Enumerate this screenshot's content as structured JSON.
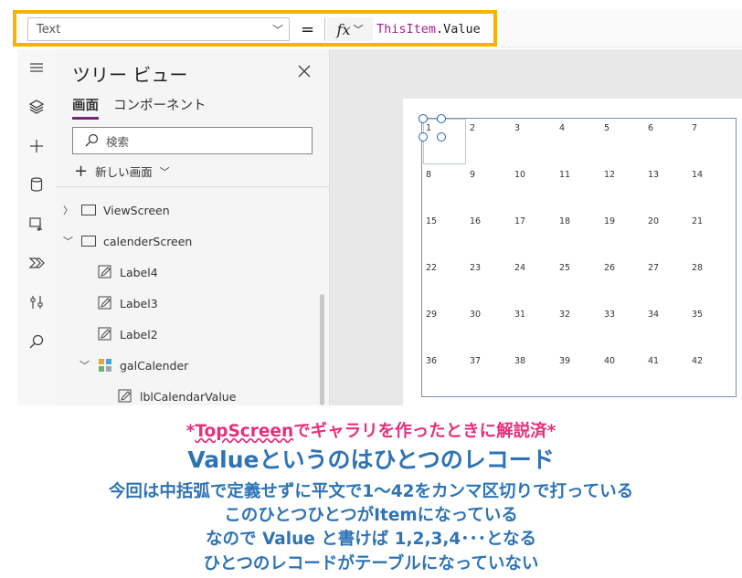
{
  "formula_bar": {
    "property": "Text",
    "equals": "=",
    "fx": "fx",
    "formula_this": "ThisItem",
    "formula_dot": ".",
    "formula_value": "Value"
  },
  "tree_view": {
    "title": "ツリー ビュー",
    "tabs": [
      "画面",
      "コンポーネント"
    ],
    "search_placeholder": "検索",
    "new_screen": "新しい画面",
    "items": [
      {
        "label": "ViewScreen",
        "expanded": false
      },
      {
        "label": "calenderScreen",
        "expanded": true
      },
      {
        "label": "Label4"
      },
      {
        "label": "Label3"
      },
      {
        "label": "Label2"
      },
      {
        "label": "galCalender",
        "expanded": true
      },
      {
        "label": "lblCalendarValue"
      }
    ]
  },
  "gallery": {
    "values": [
      "1",
      "2",
      "3",
      "4",
      "5",
      "6",
      "7",
      "8",
      "9",
      "10",
      "11",
      "12",
      "13",
      "14",
      "15",
      "16",
      "17",
      "18",
      "19",
      "20",
      "21",
      "22",
      "23",
      "24",
      "25",
      "26",
      "27",
      "28",
      "29",
      "30",
      "31",
      "32",
      "33",
      "34",
      "35",
      "36",
      "37",
      "38",
      "39",
      "40",
      "41",
      "42"
    ]
  },
  "annotations": {
    "line1_prefix": "*",
    "line1_link": "TopScreen",
    "line1_suffix": "でギャラリを作ったときに解説済*",
    "line2": "Valueというのはひとつのレコード",
    "line3": "今回は中括弧で定義せずに平文で1～42をカンマ区切りで打っている",
    "line4": "このひとつひとつがItemになっている",
    "line5": "なので  Value  と書けば  1,2,3,4･･･となる",
    "line6": "ひとつのレコードがテーブルになっていない"
  },
  "colors": {
    "highlight_border": "#f5b400",
    "keyword": "#a31e8c",
    "annotation_pink": "#e7307c",
    "annotation_blue": "#2e74b5",
    "tab_underline": "#742774"
  }
}
